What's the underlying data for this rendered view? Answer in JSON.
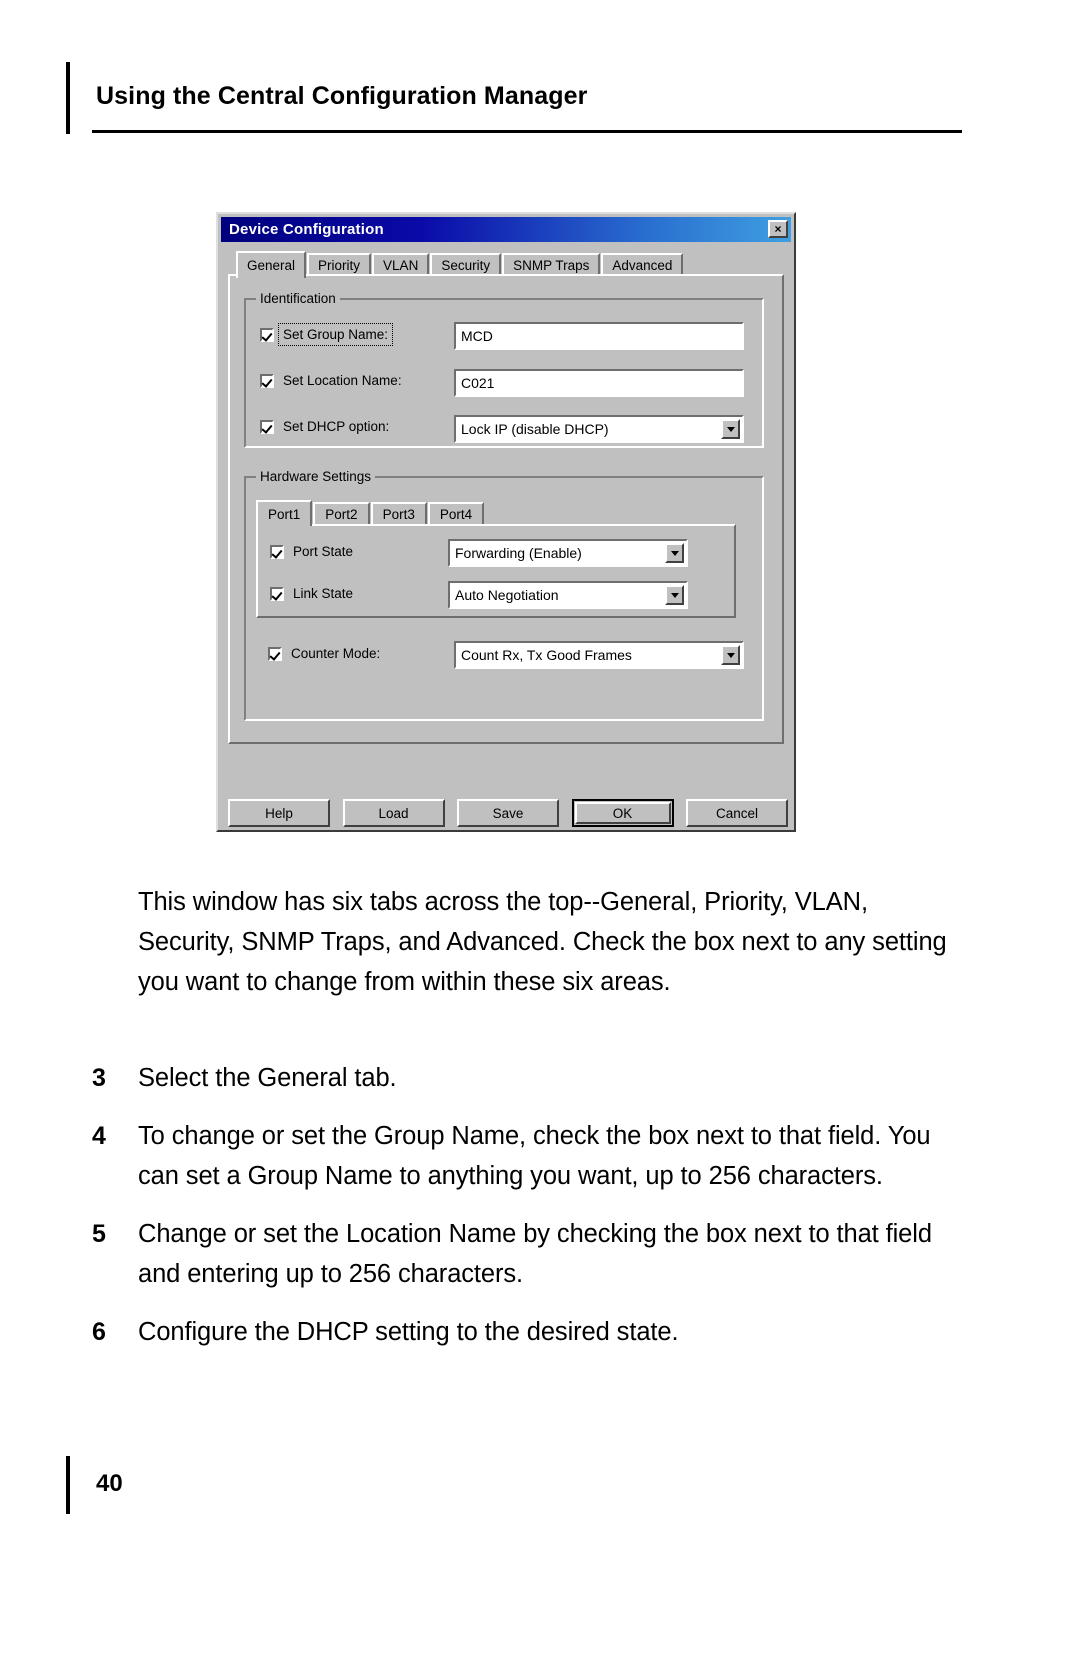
{
  "page": {
    "running_header": "Using the Central Configuration Manager",
    "page_number": "40"
  },
  "dialog": {
    "title": "Device Configuration",
    "close_label": "×",
    "tabs": [
      {
        "label": "General",
        "active": true
      },
      {
        "label": "Priority",
        "active": false
      },
      {
        "label": "VLAN",
        "active": false
      },
      {
        "label": "Security",
        "active": false
      },
      {
        "label": "SNMP Traps",
        "active": false
      },
      {
        "label": "Advanced",
        "active": false
      }
    ],
    "identification": {
      "legend": "Identification",
      "group_name": {
        "checkbox_label": "Set Group Name:",
        "checked": true,
        "value": "MCD"
      },
      "location_name": {
        "checkbox_label": "Set Location Name:",
        "checked": true,
        "value": "C021"
      },
      "dhcp_option": {
        "checkbox_label": "Set DHCP option:",
        "checked": true,
        "value": "Lock IP (disable DHCP)"
      }
    },
    "hardware_settings": {
      "legend": "Hardware Settings",
      "port_tabs": [
        {
          "label": "Port1",
          "active": true
        },
        {
          "label": "Port2",
          "active": false
        },
        {
          "label": "Port3",
          "active": false
        },
        {
          "label": "Port4",
          "active": false
        }
      ],
      "port_state": {
        "checkbox_label": "Port State",
        "checked": true,
        "value": "Forwarding (Enable)"
      },
      "link_state": {
        "checkbox_label": "Link State",
        "checked": true,
        "value": "Auto Negotiation"
      },
      "counter_mode": {
        "checkbox_label": "Counter Mode:",
        "checked": true,
        "value": "Count Rx, Tx Good Frames"
      }
    },
    "buttons": {
      "help": "Help",
      "load": "Load",
      "save": "Save",
      "ok": "OK",
      "cancel": "Cancel"
    }
  },
  "content": {
    "intro_paragraph": "This window has six tabs across the top--General, Priority, VLAN, Security, SNMP Traps, and Advanced. Check the box next to any setting you want to change from within these six areas.",
    "steps": [
      {
        "number": "3",
        "text": "Select the General tab."
      },
      {
        "number": "4",
        "text": "To change or set the Group Name, check the box next to that field. You can set a Group Name to anything you want, up to 256 characters."
      },
      {
        "number": "5",
        "text": "Change or set the Location Name by checking the box next to that field and entering up to 256 characters."
      },
      {
        "number": "6",
        "text": "Configure the DHCP setting to the desired state."
      }
    ]
  }
}
